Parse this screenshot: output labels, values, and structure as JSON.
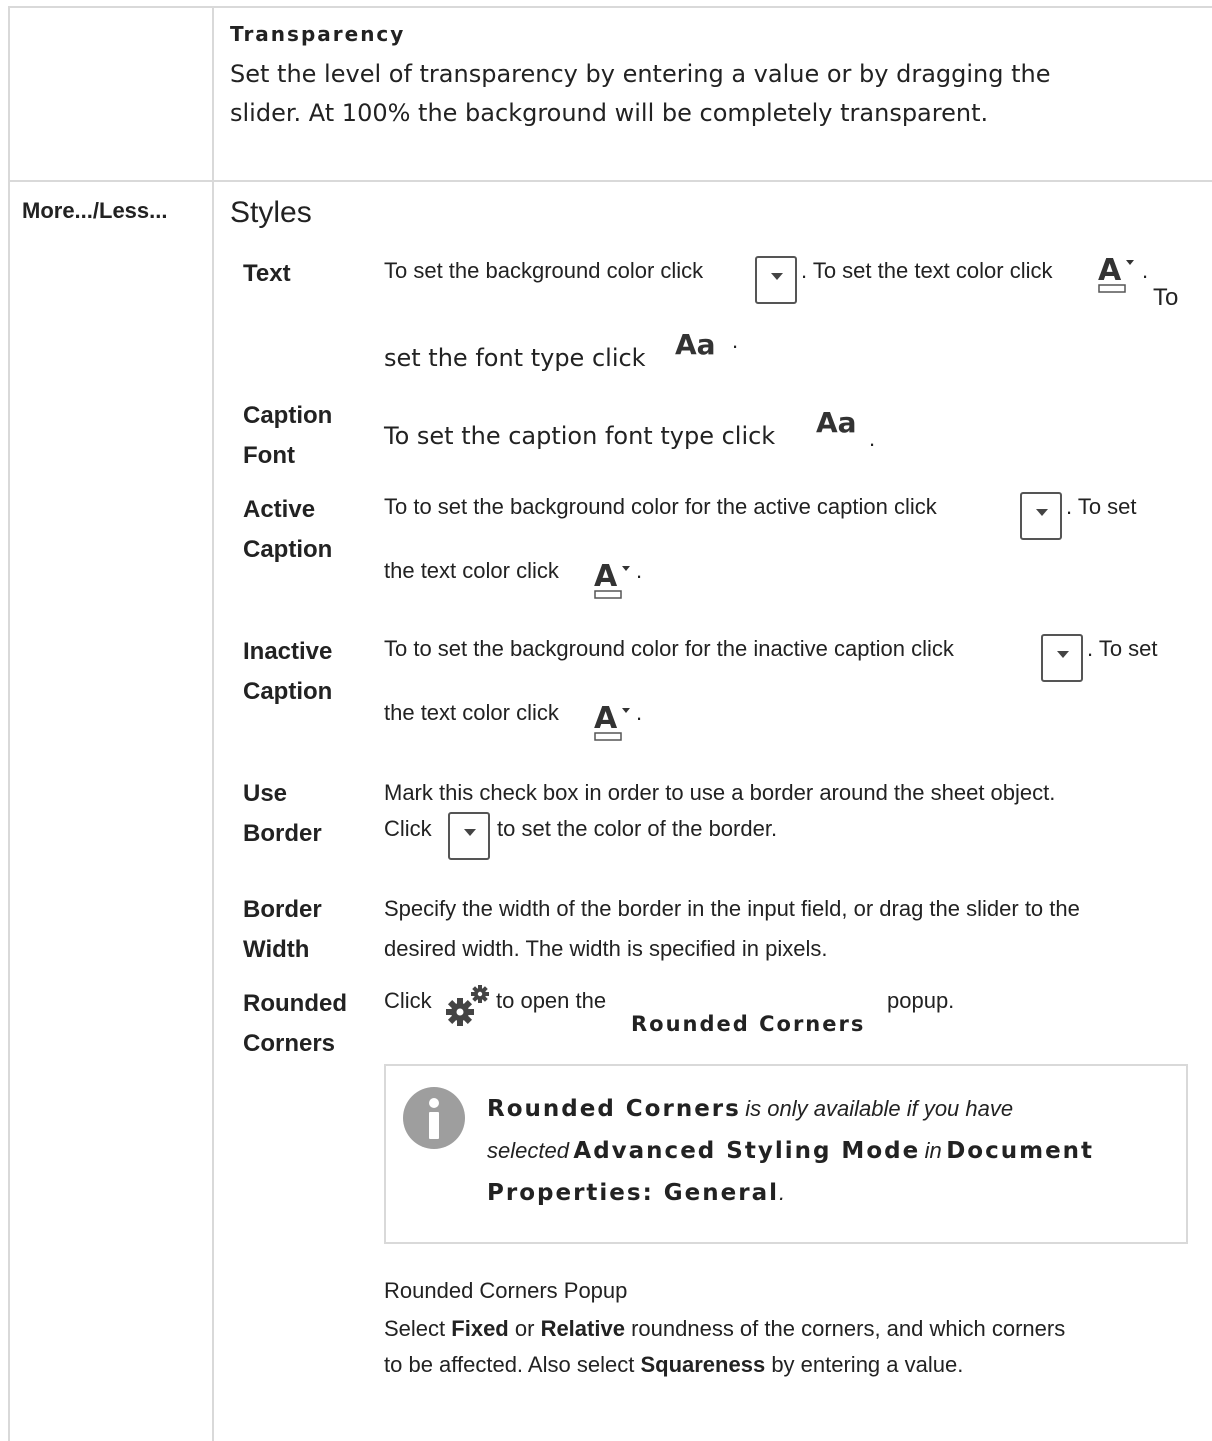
{
  "transparency": {
    "title": "Transparency",
    "line1": "Set the level of transparency by entering a value or by dragging the",
    "line2": "slider. At 100% the background will be completely transparent."
  },
  "row_label": "More.../Less...",
  "styles_heading": "Styles",
  "text": {
    "label": "Text",
    "p1": "To set the background color click",
    "p2": ". To set the text color click",
    "p3": ".",
    "p4": "To",
    "p5": "set the font type click",
    "p6": "."
  },
  "caption_font": {
    "label1": "Caption",
    "label2": "Font",
    "p1": "To set the caption font type click",
    "p2": "."
  },
  "active_caption": {
    "label1": "Active",
    "label2": "Caption",
    "p1": "To to set the background color for the active caption click",
    "p2": ". To set",
    "p3": "the text color click",
    "p4": "."
  },
  "inactive_caption": {
    "label1": "Inactive",
    "label2": "Caption",
    "p1": "To to set the background color for the inactive caption click",
    "p2": ". To set",
    "p3": "the text color click",
    "p4": "."
  },
  "use_border": {
    "label1": "Use",
    "label2": "Border",
    "p1": "Mark this check box in order to use a border around the sheet object.",
    "p2": "Click",
    "p3": "to set the color of the border."
  },
  "border_width": {
    "label1": "Border",
    "label2": "Width",
    "p1": "Specify the width of the border in the input field, or drag the slider to the",
    "p2": "desired width. The width is specified in pixels."
  },
  "rounded_corners": {
    "label1": "Rounded",
    "label2": "Corners",
    "p1": "Click",
    "p2": "to open the",
    "p3": "Rounded Corners",
    "p4": "popup."
  },
  "note": {
    "b1": "Rounded Corners",
    "i1": "is only available if you have",
    "i2": "selected",
    "b2": "Advanced Styling Mode",
    "i3": "in",
    "b3": "Document",
    "b4": "Properties: General",
    "end": "."
  },
  "popup": {
    "title": "Rounded Corners Popup",
    "l1a": "Select",
    "l1b": "Fixed",
    "l1c": "or",
    "l1d": "Relative",
    "l1e": "roundness of the corners, and which corners",
    "l2a": "to be affected. Also select",
    "l2b": "Squareness",
    "l2c": "by entering a value."
  },
  "icons": {
    "dropdown": "dropdown-arrow-icon",
    "text_color": "text-color-icon",
    "font": "font-type-icon",
    "gear": "gear-icon",
    "info": "info-icon"
  },
  "colors": {
    "grid": "#d9d9d9",
    "text": "#222222",
    "info_icon": "#9e9e9e"
  },
  "font_icon_text": "Aa"
}
